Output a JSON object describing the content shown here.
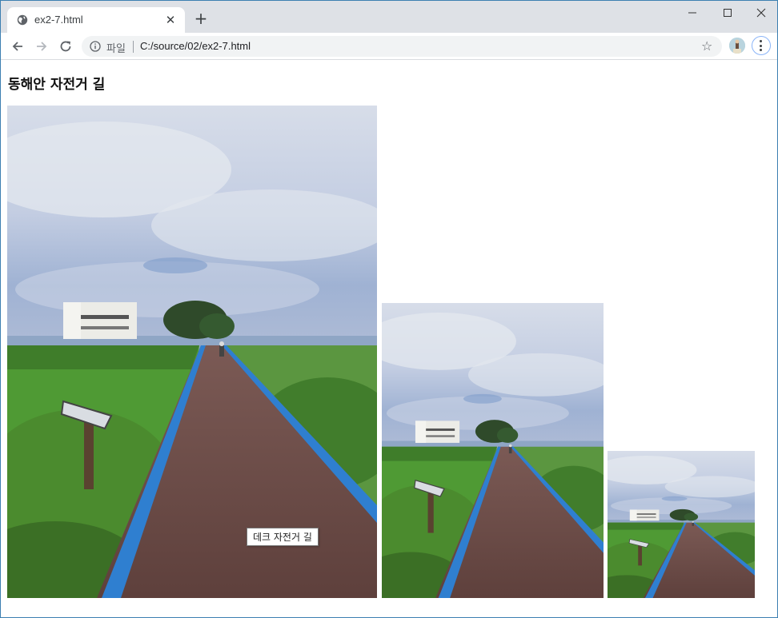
{
  "browser": {
    "tab_title": "ex2-7.html",
    "address_scheme_label": "파일",
    "address_url": "C:/source/02/ex2-7.html",
    "icons": [
      "globe-icon",
      "close-icon",
      "plus-icon",
      "minimize-icon",
      "maximize-icon",
      "window-close-icon",
      "back-arrow-icon",
      "forward-arrow-icon",
      "reload-icon",
      "info-icon",
      "star-icon",
      "profile-avatar",
      "kebab-menu-icon"
    ]
  },
  "page": {
    "heading": "동해안 자전거 길",
    "tooltip": "데크 자전거 길",
    "images": [
      {
        "name": "bike-path-photo-large"
      },
      {
        "name": "bike-path-photo-medium"
      },
      {
        "name": "bike-path-photo-small"
      }
    ]
  },
  "colors": {
    "tab_strip": "#dee1e6",
    "omnibox": "#f1f3f4",
    "deck": "#6b4a45",
    "deck_stripe": "#2f7fd0"
  }
}
